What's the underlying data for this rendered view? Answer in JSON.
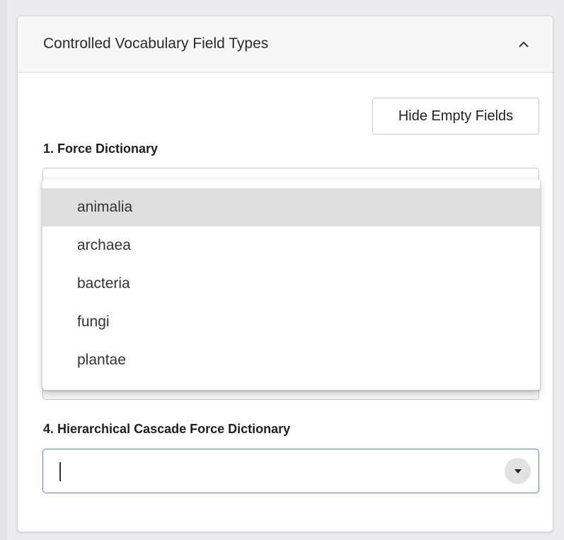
{
  "card": {
    "title": "Controlled Vocabulary Field Types",
    "collapse_icon": "chevron-up-icon"
  },
  "toolbar": {
    "hide_empty_label": "Hide Empty Fields"
  },
  "fields": {
    "force_dictionary": {
      "label": "1. Force Dictionary",
      "options": [
        "animalia",
        "archaea",
        "bacteria",
        "fungi",
        "plantae"
      ],
      "highlighted_option": "animalia"
    },
    "hierarchical_cascade": {
      "label": "4. Hierarchical Cascade Force Dictionary",
      "value": "",
      "toggle_icon": "caret-down-icon"
    }
  },
  "colors": {
    "focus_border": "#4f86d9",
    "option_highlight": "#dfdfdf",
    "header_background": "#f7f7f7"
  }
}
